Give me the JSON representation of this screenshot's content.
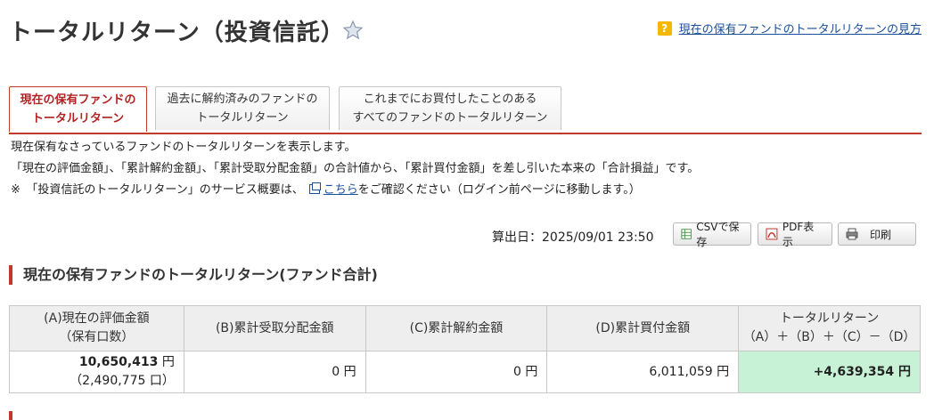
{
  "page": {
    "title": "トータルリターン（投資信託）",
    "help_badge": "?",
    "help_link": "現在の保有ファンドのトータルリターンの見方"
  },
  "tabs": [
    {
      "line1": "現在の保有ファンドの",
      "line2": "トータルリターン",
      "active": true
    },
    {
      "line1": "過去に解約済みのファンドの",
      "line2": "トータルリターン",
      "active": false
    },
    {
      "line1": "これまでにお買付したことのある",
      "line2": "すべてのファンドのトータルリターン",
      "active": false
    }
  ],
  "description": {
    "line1": "現在保有なさっているファンドのトータルリターンを表示します。",
    "line2": "「現在の評価金額」、「累計解約金額」、「累計受取分配金額」の合計値から、「累計買付金額」を差し引いた本来の「合計損益」です。",
    "line3_prefix": "※　「投資信託のトータルリターン」のサービス概要は、",
    "line3_link": "こちら",
    "line3_suffix": "をご確認ください（ログイン前ページに移動します。）"
  },
  "toolbar": {
    "calc_date": "算出日：2025/09/01 23:50",
    "csv_label": "CSVで保存",
    "pdf_label": "PDF表示",
    "print_label": "印刷"
  },
  "section": {
    "title": "現在の保有ファンドのトータルリターン(ファンド合計)"
  },
  "summary": {
    "headers": {
      "a_line1": "(A)現在の評価金額",
      "a_line2": "（保有口数）",
      "b": "(B)累計受取分配金額",
      "c": "(C)累計解約金額",
      "d": "(D)累計買付金額",
      "tr_line1": "トータルリターン",
      "tr_line2": "（A）＋（B）＋（C）－（D）"
    },
    "values": {
      "a_amount": "10,650,413",
      "a_unit": "円",
      "a_holdings": "（2,490,775 口）",
      "b": "0 円",
      "c": "0 円",
      "d": "6,011,059 円",
      "tr": "+4,639,354 円"
    }
  },
  "colors": {
    "accent_red": "#c0392b",
    "link_blue": "#1a4f9c",
    "positive_bg": "#c8f2d6",
    "positive_text": "#d0201a",
    "help_badge": "#f5b800"
  },
  "icons": [
    "star-icon",
    "help-icon",
    "external-window-icon",
    "csv-icon",
    "pdf-icon",
    "printer-icon"
  ]
}
